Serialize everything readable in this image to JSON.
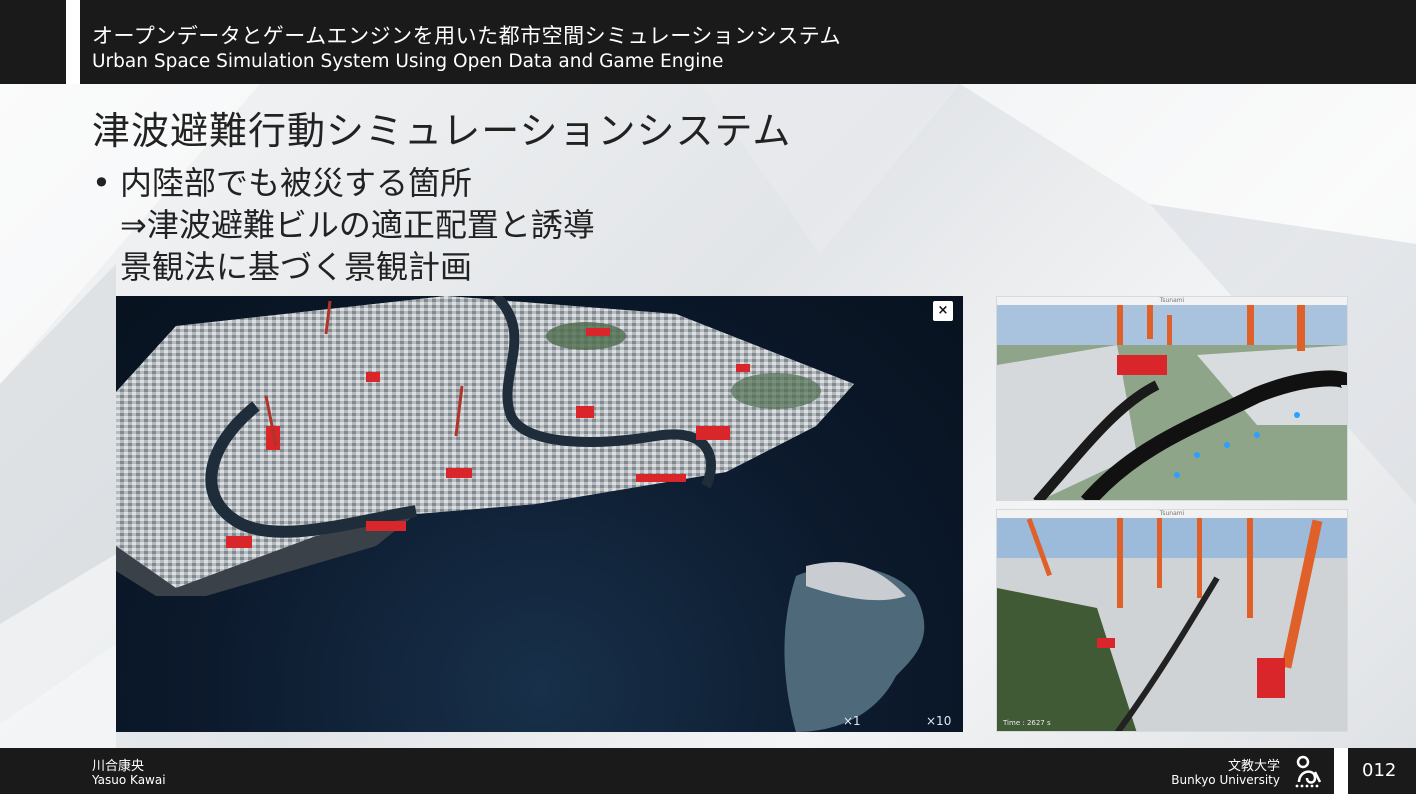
{
  "header": {
    "title_ja": "オープンデータとゲームエンジンを用いた都市空間シミュレーションシステム",
    "title_en": "Urban Space Simulation System Using Open Data and Game Engine"
  },
  "slide": {
    "title": "津波避難行動シミュレーションシステム",
    "bullets": [
      "内陸部でも被災する箇所",
      "⇒津波避難ビルの適正配置と誘導",
      "景観法に基づく景観計画"
    ],
    "bullet_marker": "•"
  },
  "main_image": {
    "close_label": "×",
    "speed_a": "×1",
    "speed_b": "×10"
  },
  "side_images": {
    "top_title": "Tsunami",
    "bottom_title": "Tsunami",
    "bottom_caption": "Time : 2627 s"
  },
  "footer": {
    "author_ja": "川合康央",
    "author_en": "Yasuo Kawai",
    "university_ja": "文教大学",
    "university_en": "Bunkyo University",
    "page_number": "012"
  },
  "colors": {
    "header_bg": "#1a1a1a",
    "highlight_red": "#d9262a",
    "tower_orange": "#e0602a",
    "sea_blue": "#0c1a2d"
  }
}
